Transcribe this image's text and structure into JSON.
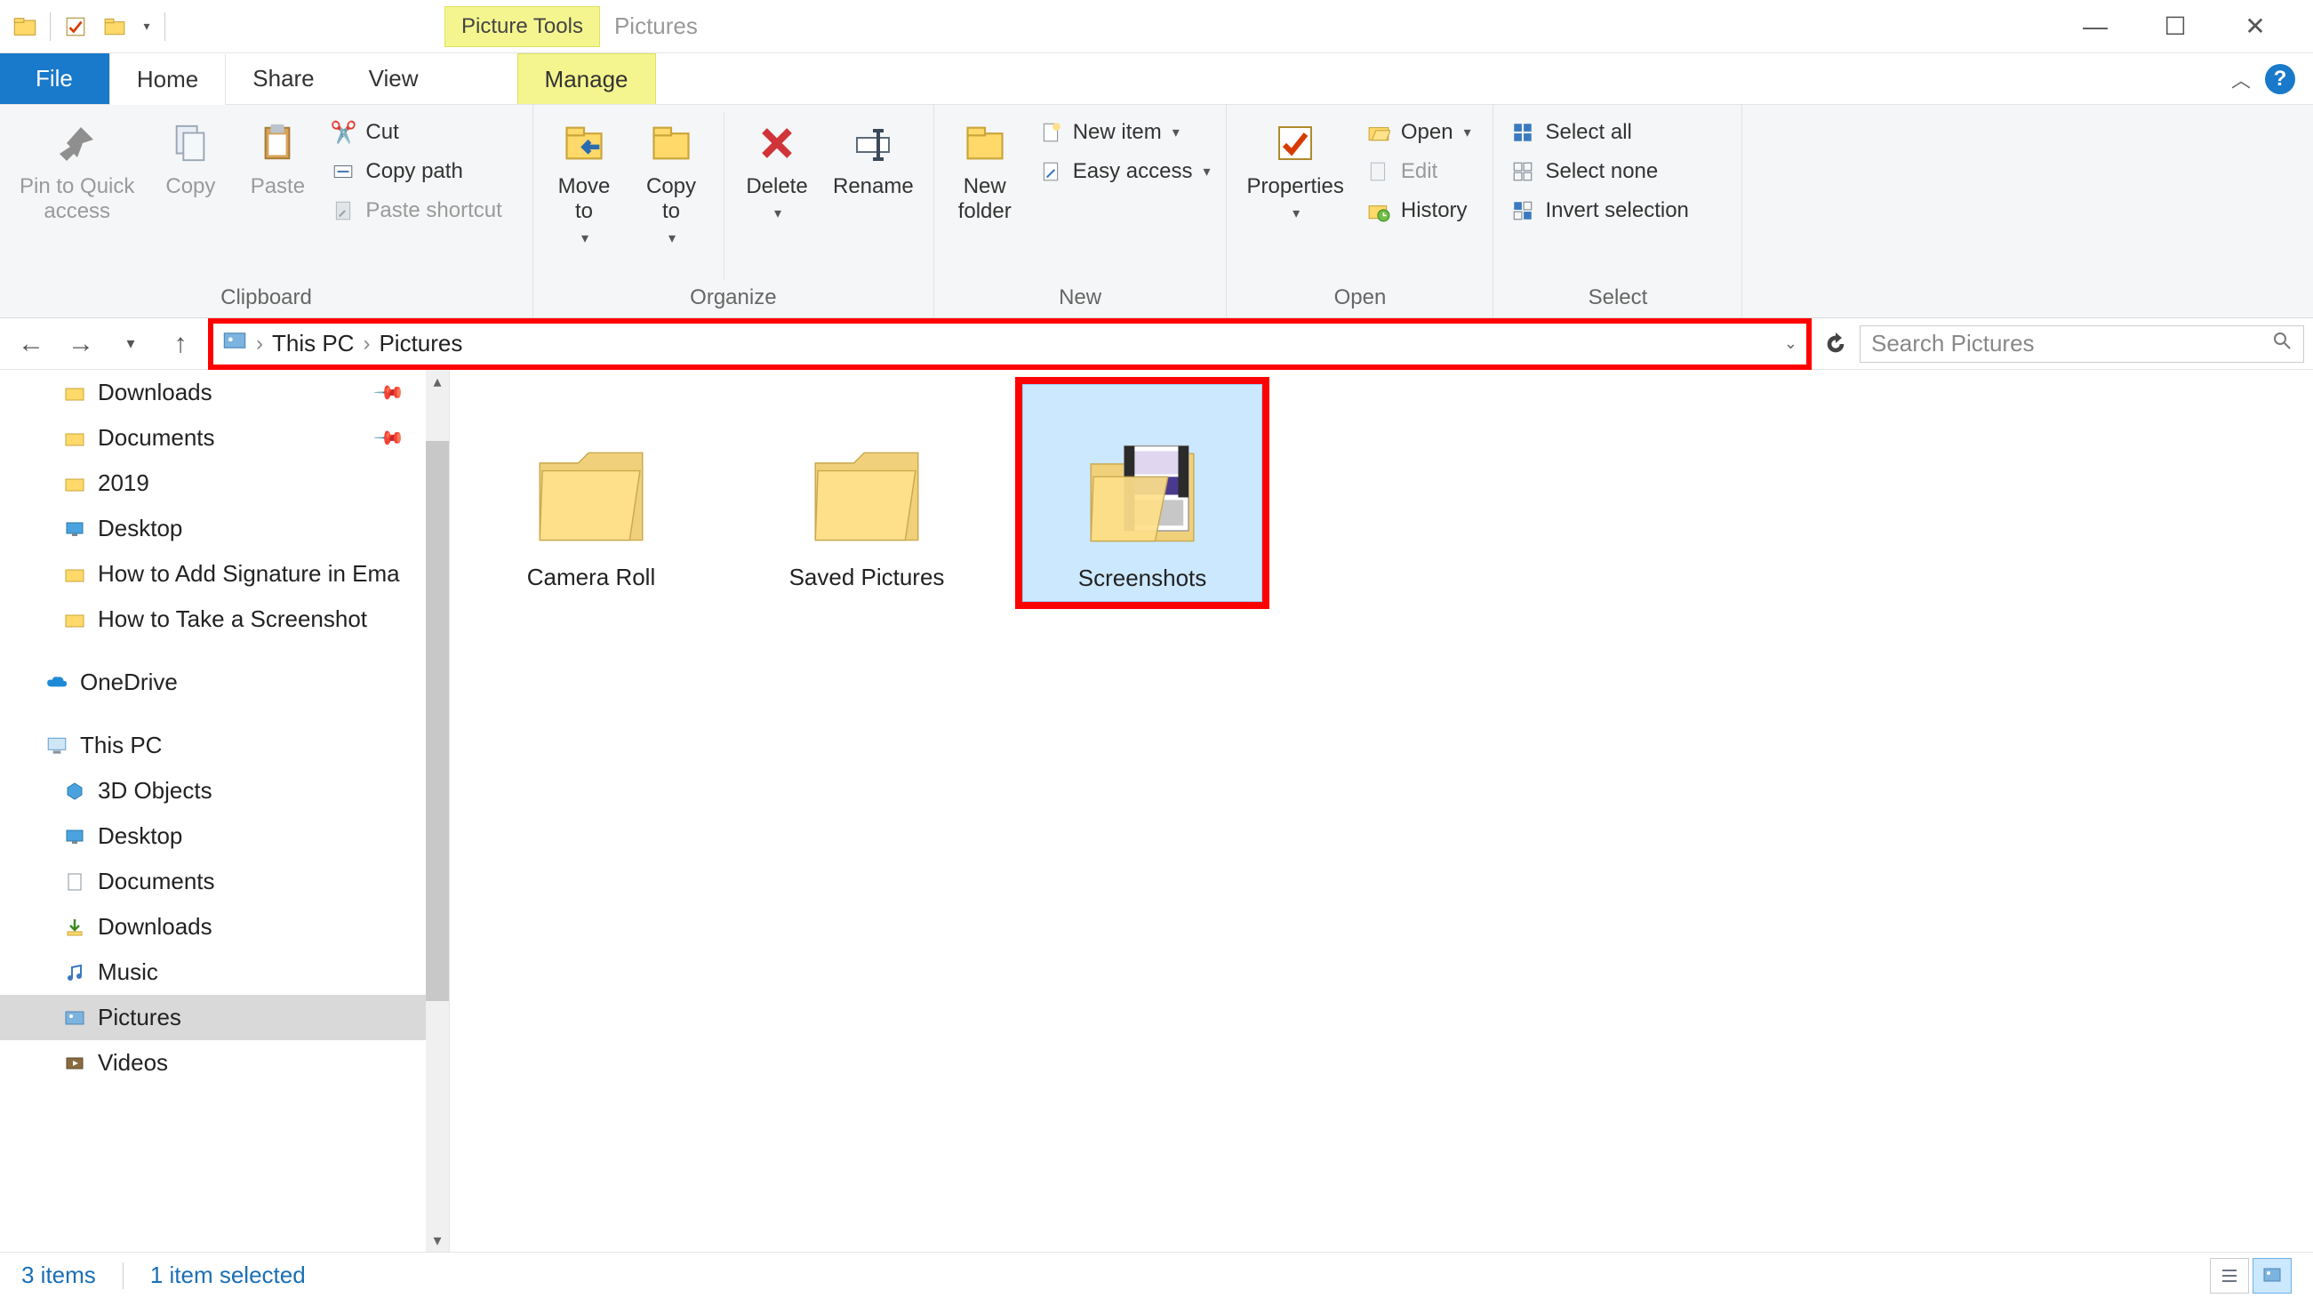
{
  "window": {
    "title": "Pictures",
    "context_tab": "Picture Tools"
  },
  "tabs": {
    "file": "File",
    "home": "Home",
    "share": "Share",
    "view": "View",
    "manage": "Manage"
  },
  "ribbon": {
    "clipboard": {
      "label": "Clipboard",
      "pin_quick": "Pin to Quick\naccess",
      "copy": "Copy",
      "paste": "Paste",
      "cut": "Cut",
      "copy_path": "Copy path",
      "paste_shortcut": "Paste shortcut"
    },
    "organize": {
      "label": "Organize",
      "move_to": "Move\nto",
      "copy_to": "Copy\nto",
      "delete": "Delete",
      "rename": "Rename"
    },
    "new": {
      "label": "New",
      "new_folder": "New\nfolder",
      "new_item": "New item",
      "easy_access": "Easy access"
    },
    "open": {
      "label": "Open",
      "properties": "Properties",
      "open": "Open",
      "edit": "Edit",
      "history": "History"
    },
    "select": {
      "label": "Select",
      "select_all": "Select all",
      "select_none": "Select none",
      "invert": "Invert selection"
    }
  },
  "breadcrumb": {
    "this_pc": "This PC",
    "pictures": "Pictures"
  },
  "search": {
    "placeholder": "Search Pictures"
  },
  "tree": {
    "downloads": "Downloads",
    "documents": "Documents",
    "y2019": "2019",
    "desktop": "Desktop",
    "howto_sig": "How to Add Signature in Ema",
    "howto_ss": "How to Take a Screenshot",
    "onedrive": "OneDrive",
    "this_pc": "This PC",
    "objects3d": "3D Objects",
    "desktop2": "Desktop",
    "documents2": "Documents",
    "downloads2": "Downloads",
    "music": "Music",
    "pictures": "Pictures",
    "videos": "Videos"
  },
  "folders": {
    "camera_roll": "Camera Roll",
    "saved_pictures": "Saved Pictures",
    "screenshots": "Screenshots"
  },
  "status": {
    "count": "3 items",
    "selected": "1 item selected"
  }
}
